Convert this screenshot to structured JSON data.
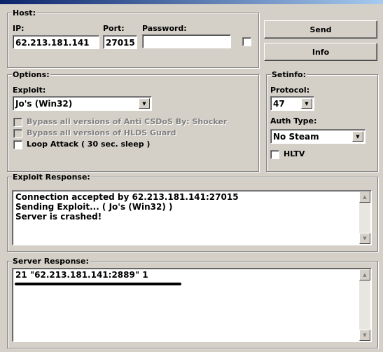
{
  "host": {
    "legend": "Host:",
    "ip_label": "IP:",
    "ip_value": "62.213.181.141",
    "port_label": "Port:",
    "port_value": "27015",
    "password_label": "Password:",
    "password_value": ""
  },
  "buttons": {
    "send": "Send",
    "info": "Info"
  },
  "options": {
    "legend": "Options:",
    "exploit_label": "Exploit:",
    "exploit_value": "Jo's (Win32)",
    "bypass_csdos": "Bypass all versions of Anti CSDoS By: Shocker",
    "bypass_hlds": "Bypass all versions of HLDS Guard",
    "loop_attack": "Loop Attack ( 30 sec. sleep )"
  },
  "setinfo": {
    "legend": "Setinfo:",
    "protocol_label": "Protocol:",
    "protocol_value": "47",
    "auth_label": "Auth Type:",
    "auth_value": "No Steam",
    "hltv": "HLTV"
  },
  "exploit_response": {
    "legend": "Exploit Response:",
    "lines": [
      "Connection accepted by 62.213.181.141:27015",
      "Sending Exploit... ( Jo's (Win32) )",
      "Server is crashed!"
    ]
  },
  "server_response": {
    "legend": "Server Response:",
    "lines": [
      "21 \"62.213.181.141:2889\" 1"
    ]
  }
}
